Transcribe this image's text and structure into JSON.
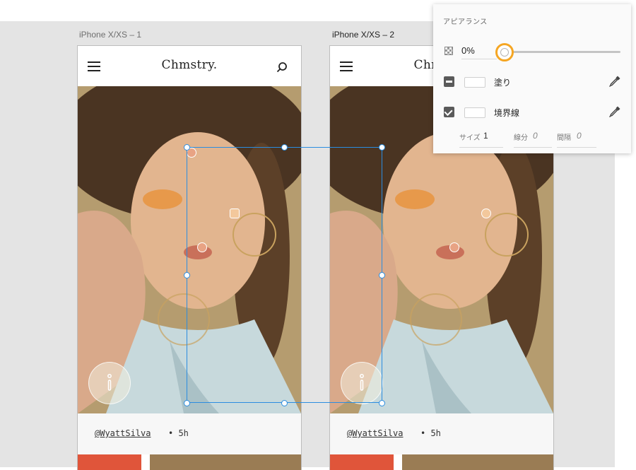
{
  "artboards": [
    {
      "label": "iPhone X/XS – 1",
      "brand": "Chmstry.",
      "handle": "@WyattSilva",
      "time": "• 5h"
    },
    {
      "label": "iPhone X/XS – 2",
      "brand": "Chmstry.",
      "handle": "@WyattSilva",
      "time": "• 5h"
    }
  ],
  "panel": {
    "title": "アピアランス",
    "opacity_value": "0%",
    "opacity_fraction": 0,
    "fill_label": "塗り",
    "border_label": "境界線",
    "size_label": "サイズ",
    "size_value": "1",
    "dash_label": "線分",
    "dash_value": "0",
    "gap_label": "間隔",
    "gap_value": "0"
  },
  "colors": {
    "accent_orange": "#f5a623",
    "selection_blue": "#2b8de0",
    "thumb_orange": "#e0553a",
    "hotspot_peach": "#e8a384",
    "hotspot_light": "#f3c89c"
  },
  "icons": [
    "hamburger-icon",
    "search-icon",
    "info-icon",
    "opacity-checker-icon",
    "eyedropper-icon"
  ]
}
